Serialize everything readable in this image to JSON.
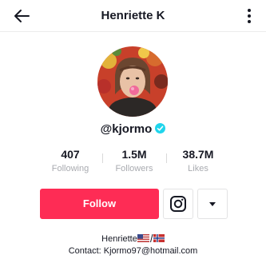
{
  "header": {
    "title": "Henriette K",
    "back_icon": "back-arrow-icon",
    "more_icon": "vertical-dots-icon"
  },
  "profile": {
    "handle": "@kjormo",
    "verified_icon": "verified-check-icon",
    "stats": [
      {
        "value": "407",
        "label": "Following"
      },
      {
        "value": "1.5M",
        "label": "Followers"
      },
      {
        "value": "38.7M",
        "label": "Likes"
      }
    ]
  },
  "actions": {
    "follow_label": "Follow",
    "instagram_icon": "instagram-icon",
    "dropdown_icon": "caret-down-icon"
  },
  "bio": {
    "name": "Henriette",
    "flags_icon": "us-flag-norway-flag-icon",
    "contact": "Contact: Kjormo97@hotmail.com"
  },
  "colors": {
    "accent": "#fe2c55",
    "verified": "#20d5ec",
    "muted": "#a9abb0"
  }
}
